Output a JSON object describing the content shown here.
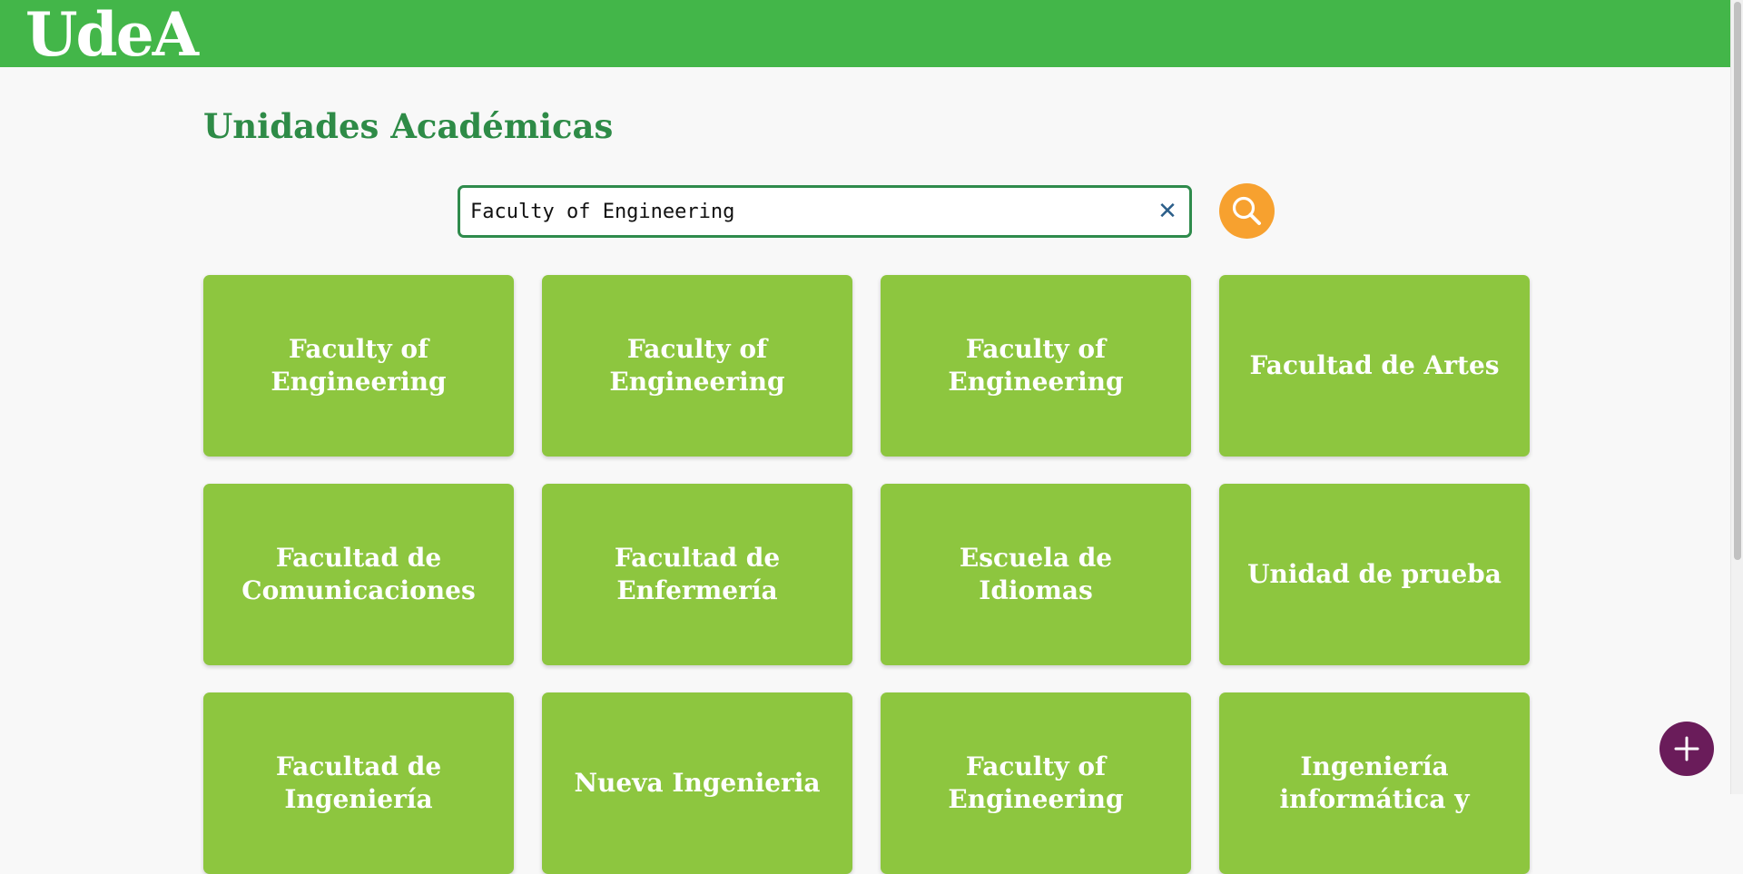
{
  "header": {
    "brand": "UdeA",
    "color": "#43b649"
  },
  "page": {
    "title": "Unidades Académicas"
  },
  "search": {
    "value": "Faculty of Engineering",
    "clear_icon": "close-icon",
    "button_icon": "search-icon"
  },
  "units": [
    "Faculty of Engineering",
    "Faculty of Engineering",
    "Faculty of Engineering",
    "Facultad de Artes",
    "Facultad de Comunicaciones",
    "Facultad de Enfermería",
    "Escuela de Idiomas",
    "Unidad de prueba",
    "Facultad de Ingeniería",
    "Nueva Ingenieria",
    "Faculty of Engineering",
    "Ingeniería informática y"
  ],
  "fab": {
    "icon": "plus-icon",
    "color": "#6a1c5a"
  },
  "colors": {
    "card": "#8dc63f",
    "title": "#2e8b47",
    "search_button": "#f7a12f"
  }
}
